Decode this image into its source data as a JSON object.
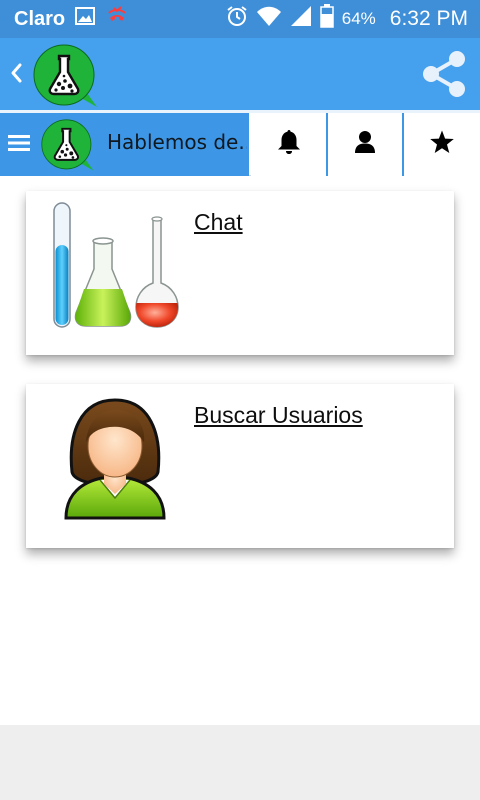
{
  "status_bar": {
    "carrier": "Claro",
    "battery_percent": "64%",
    "time": "6:32 PM",
    "icons": [
      "image-icon",
      "missed-call-icon",
      "alarm-icon",
      "wifi-icon",
      "signal-icon",
      "battery-icon"
    ]
  },
  "app_bar": {
    "icons": [
      "back-icon",
      "flask-logo",
      "share-icon"
    ],
    "color": "#45a1ee"
  },
  "tab_bar": {
    "title": "Hablemos de...",
    "icons": [
      "menu-icon",
      "flask-logo",
      "bell-icon",
      "person-icon",
      "star-icon"
    ],
    "active_color": "#3d97e6"
  },
  "cards": [
    {
      "label": "Chat",
      "icon": "lab-glassware-icon"
    },
    {
      "label": "Buscar Usuarios",
      "icon": "user-avatar-icon"
    }
  ],
  "colors": {
    "status_bar": "#3f8fd8",
    "logo_green": "#1fb33a",
    "footer": "#eeeeee"
  }
}
